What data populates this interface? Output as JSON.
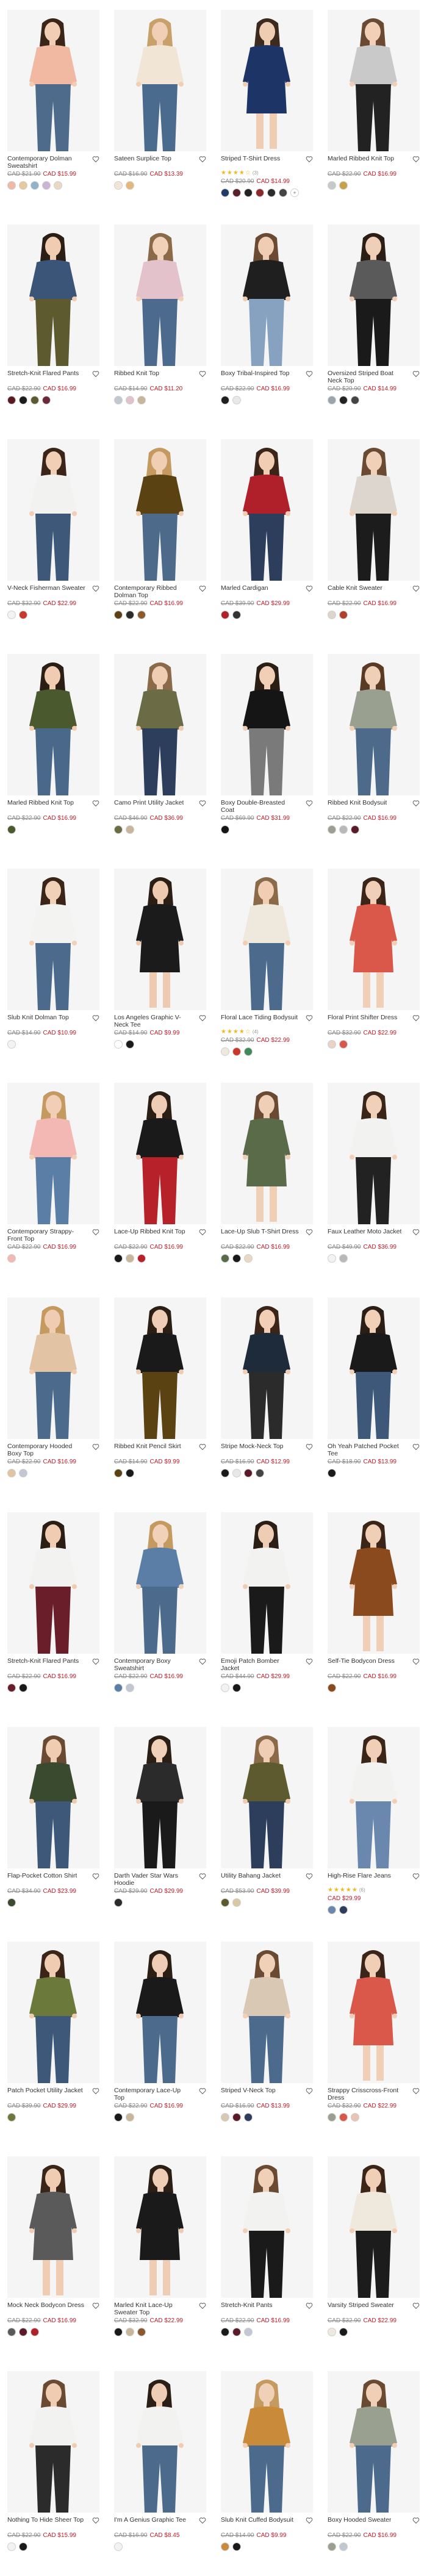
{
  "ui": {
    "heart_label": "Add to wishlist",
    "plus_label": "+"
  },
  "products": [
    {
      "name": "Contemporary Dolman Sweatshirt",
      "orig": "CAD $21.90",
      "sale": "CAD $15.99",
      "rating": 0,
      "reviews": "",
      "skin": "#f2cdb5",
      "hair": "#3a2518",
      "top": "#f1b8a2",
      "bottom": "#4e6b8c",
      "bg": "#f5f5f5",
      "swatches": [
        "#f1b8a2",
        "#e7c89f",
        "#8fb3c9",
        "#c9b5d6",
        "#e8d8c4"
      ]
    },
    {
      "name": "Sateen Surplice Top",
      "orig": "CAD $16.90",
      "sale": "CAD $13.39",
      "rating": 0,
      "reviews": "",
      "skin": "#f0cfb6",
      "hair": "#c7a06a",
      "top": "#f1e6d6",
      "bottom": "#4b6b8e",
      "bg": "#f5f5f5",
      "swatches": [
        "#f1e6d6",
        "#e3b77f"
      ]
    },
    {
      "name": "Striped T-Shirt Dress",
      "orig": "CAD $20.90",
      "sale": "CAD $14.99",
      "rating": 4,
      "reviews": "(3)",
      "skin": "#efcdb2",
      "hair": "#3b2a1d",
      "top": "#1d3566",
      "bottom": "#1d3566",
      "bg": "#f5f5f5",
      "swatches": [
        "#1f3b6a",
        "#5b1f2b",
        "#222",
        "#8a2a2a",
        "#2b2b2b",
        "#444"
      ],
      "plus": true
    },
    {
      "name": "Marled Ribbed Knit Top",
      "orig": "CAD $22.90",
      "sale": "CAD $16.99",
      "rating": 0,
      "reviews": "",
      "skin": "#f1d0b7",
      "hair": "#6a4a32",
      "top": "#c9c9c9",
      "bottom": "#222",
      "bg": "#f5f5f5",
      "swatches": [
        "#c9c9c9",
        "#c8a14a"
      ]
    },
    {
      "name": "Stretch-Knit Flared Pants",
      "orig": "CAD $22.90",
      "sale": "CAD $16.99",
      "rating": 0,
      "reviews": "",
      "skin": "#f0cdb2",
      "hair": "#2b1e15",
      "top": "#3a5578",
      "bottom": "#5c5a2e",
      "bg": "#f5f5f5",
      "swatches": [
        "#5b1a1f",
        "#1c1c1c",
        "#5c5a2e",
        "#6b2a3a"
      ]
    },
    {
      "name": "Ribbed Knit Top",
      "orig": "CAD $14.90",
      "sale": "CAD $11.20",
      "rating": 0,
      "reviews": "",
      "skin": "#f1d1b8",
      "hair": "#8a6a48",
      "top": "#e3c2cc",
      "bottom": "#4b6a8d",
      "bg": "#f5f5f5",
      "swatches": [
        "#c2c8d2",
        "#e3c2cc",
        "#c8b59a"
      ]
    },
    {
      "name": "Boxy Tribal-Inspired Top",
      "orig": "CAD $22.90",
      "sale": "CAD $16.99",
      "rating": 0,
      "reviews": "",
      "skin": "#eecdb4",
      "hair": "#6a4a32",
      "top": "#1f1f1f",
      "bottom": "#86a2c0",
      "bg": "#f5f5f5",
      "swatches": [
        "#1f1f1f",
        "#e8e8e8"
      ]
    },
    {
      "name": "Oversized Striped Boat Neck Top",
      "orig": "CAD $20.90",
      "sale": "CAD $14.99",
      "rating": 0,
      "reviews": "",
      "skin": "#f0cfb8",
      "hair": "#2b1e15",
      "top": "#5a5a5a",
      "bottom": "#1a1a1a",
      "bg": "#f5f5f5",
      "swatches": [
        "#9aa3b0",
        "#222",
        "#444"
      ]
    },
    {
      "name": "V-Neck Fisherman Sweater",
      "orig": "CAD $32.90",
      "sale": "CAD $22.99",
      "rating": 0,
      "reviews": "",
      "skin": "#f1cfb7",
      "hair": "#3a2518",
      "top": "#f2f2f0",
      "bottom": "#3e5879",
      "bg": "#f5f5f5",
      "swatches": [
        "#f2f2f0",
        "#c7392a"
      ]
    },
    {
      "name": "Contemporary Ribbed Dolman Top",
      "orig": "CAD $22.90",
      "sale": "CAD $16.99",
      "rating": 0,
      "reviews": "",
      "skin": "#f0ceb4",
      "hair": "#c59a60",
      "top": "#5a4212",
      "bottom": "#4d6a8a",
      "bg": "#f5f5f5",
      "swatches": [
        "#5a4212",
        "#2b2b2b",
        "#8a5a2e"
      ]
    },
    {
      "name": "Marled Cardigan",
      "orig": "CAD $39.90",
      "sale": "CAD $29.99",
      "rating": 0,
      "reviews": "",
      "skin": "#f0cdb3",
      "hair": "#3a2518",
      "top": "#b0202a",
      "bottom": "#2c3e5c",
      "bg": "#f5f5f5",
      "swatches": [
        "#b0202a",
        "#333"
      ]
    },
    {
      "name": "Cable Knit Sweater",
      "orig": "CAD $22.90",
      "sale": "CAD $16.99",
      "rating": 0,
      "reviews": "",
      "skin": "#f1d0b8",
      "hair": "#6a4a32",
      "top": "#dcd6cf",
      "bottom": "#1c1c1c",
      "bg": "#f5f5f5",
      "swatches": [
        "#dcd6cf",
        "#b0402a"
      ]
    },
    {
      "name": "Marled Ribbed Knit Top",
      "orig": "CAD $22.90",
      "sale": "CAD $16.99",
      "rating": 0,
      "reviews": "",
      "skin": "#f0cdb2",
      "hair": "#2b1e15",
      "top": "#4a5a2e",
      "bottom": "#4a688a",
      "bg": "#f5f5f5",
      "swatches": [
        "#4a5a2e"
      ]
    },
    {
      "name": "Camo Print Utility Jacket",
      "orig": "CAD $46.90",
      "sale": "CAD $36.99",
      "rating": 0,
      "reviews": "",
      "skin": "#eecdb3",
      "hair": "#8a6a48",
      "top": "#6b6b45",
      "bottom": "#2c3e5c",
      "bg": "#f5f5f5",
      "swatches": [
        "#6b6b45",
        "#c8b59a"
      ]
    },
    {
      "name": "Boxy Double-Breasted Coat",
      "orig": "CAD $69.90",
      "sale": "CAD $31.99",
      "rating": 0,
      "reviews": "",
      "skin": "#f0cfb6",
      "hair": "#2b1e15",
      "top": "#151515",
      "bottom": "#7a7a7a",
      "bg": "#f5f5f5",
      "swatches": [
        "#151515"
      ]
    },
    {
      "name": "Ribbed Knit Bodysuit",
      "orig": "CAD $22.90",
      "sale": "CAD $16.99",
      "rating": 0,
      "reviews": "",
      "skin": "#f0cfb7",
      "hair": "#5a3a24",
      "top": "#9aa090",
      "bottom": "#4d6a8a",
      "bg": "#f5f5f5",
      "swatches": [
        "#9aa090",
        "#b9b9b9",
        "#5b1a2a"
      ]
    },
    {
      "name": "Slub Knit Dolman Top",
      "orig": "CAD $14.90",
      "sale": "CAD $10.99",
      "rating": 0,
      "reviews": "",
      "skin": "#f1d1b8",
      "hair": "#3a2518",
      "top": "#f3f3f1",
      "bottom": "#4b6a8c",
      "bg": "#f5f5f5",
      "swatches": [
        "#f3f3f1"
      ]
    },
    {
      "name": "Los Angeles Graphic V-Neck Tee",
      "orig": "CAD $14.90",
      "sale": "CAD $9.99",
      "rating": 0,
      "reviews": "",
      "skin": "#eecbb0",
      "hair": "#2b1e15",
      "top": "#1b1b1b",
      "bottom": "#1b1b1b",
      "bg": "#f5f5f5",
      "swatches": [
        "#ffffff",
        "#1b1b1b"
      ]
    },
    {
      "name": "Floral Lace Tiding Bodysuit",
      "orig": "CAD $32.90",
      "sale": "CAD $22.99",
      "rating": 4,
      "reviews": "(4)",
      "skin": "#f0cdb3",
      "hair": "#8a6a48",
      "top": "#efe8dc",
      "bottom": "#4b6a8c",
      "bg": "#f5f5f5",
      "swatches": [
        "#efe8dc",
        "#c7392a",
        "#3e8a5a"
      ]
    },
    {
      "name": "Floral Print Shifter Dress",
      "orig": "CAD $32.90",
      "sale": "CAD $22.99",
      "rating": 0,
      "reviews": "",
      "skin": "#f1cfb6",
      "hair": "#3a2518",
      "top": "#d9584a",
      "bottom": "#d9584a",
      "bg": "#f5f5f5",
      "swatches": [
        "#e8d4c4",
        "#d9584a"
      ]
    },
    {
      "name": "Contemporary Strappy-Front Top",
      "orig": "CAD $22.90",
      "sale": "CAD $16.99",
      "rating": 0,
      "reviews": "",
      "skin": "#f0cfb6",
      "hair": "#c59a60",
      "top": "#f3b8b4",
      "bottom": "#5a7ea5",
      "bg": "#f5f5f5",
      "swatches": [
        "#f3b8b4"
      ]
    },
    {
      "name": "Lace-Up Ribbed Knit Top",
      "orig": "CAD $22.90",
      "sale": "CAD $16.99",
      "rating": 0,
      "reviews": "",
      "skin": "#eecdb4",
      "hair": "#2b1e15",
      "top": "#1a1a1a",
      "bottom": "#b7222a",
      "bg": "#f5f5f5",
      "swatches": [
        "#1a1a1a",
        "#c8b59a",
        "#b7222a"
      ]
    },
    {
      "name": "Lace-Up Slub T-Shirt Dress",
      "orig": "CAD $22.90",
      "sale": "CAD $16.99",
      "rating": 0,
      "reviews": "",
      "skin": "#f0cfb7",
      "hair": "#6a4a32",
      "top": "#5a6b4a",
      "bottom": "#5a6b4a",
      "bg": "#f5f5f5",
      "swatches": [
        "#5a6b4a",
        "#1a1a1a",
        "#e8d8c4"
      ]
    },
    {
      "name": "Faux Leather Moto Jacket",
      "orig": "CAD $49.90",
      "sale": "CAD $36.99",
      "rating": 0,
      "reviews": "",
      "skin": "#f1d0b8",
      "hair": "#3a2518",
      "top": "#f2f2f0",
      "bottom": "#222",
      "bg": "#f5f5f5",
      "swatches": [
        "#f2f2f0",
        "#b9b9b9"
      ]
    },
    {
      "name": "Contemporary Hooded Boxy Top",
      "orig": "CAD $22.90",
      "sale": "CAD $16.99",
      "rating": 0,
      "reviews": "",
      "skin": "#f0cdb2",
      "hair": "#c59a60",
      "top": "#e2c3a4",
      "bottom": "#4b6a8c",
      "bg": "#f5f5f5",
      "swatches": [
        "#e2c3a4",
        "#c2c8d2"
      ]
    },
    {
      "name": "Ribbed Knit Pencil Skirt",
      "orig": "CAD $14.90",
      "sale": "CAD $9.99",
      "rating": 0,
      "reviews": "",
      "skin": "#eecdb4",
      "hair": "#2b1e15",
      "top": "#1a1a1a",
      "bottom": "#5a4212",
      "bg": "#f5f5f5",
      "swatches": [
        "#5a4212",
        "#1a1a1a"
      ]
    },
    {
      "name": "Stripe Mock-Neck Top",
      "orig": "CAD $16.90",
      "sale": "CAD $12.99",
      "rating": 0,
      "reviews": "",
      "skin": "#f0cfb6",
      "hair": "#3a2518",
      "top": "#1d2b3a",
      "bottom": "#2b2b2b",
      "bg": "#f5f5f5",
      "swatches": [
        "#1a1a1a",
        "#e8e8e8",
        "#5b1a2a",
        "#444"
      ]
    },
    {
      "name": "Oh Yeah Patched Pocket Tee",
      "orig": "CAD $18.90",
      "sale": "CAD $13.99",
      "rating": 0,
      "reviews": "",
      "skin": "#f1d0b8",
      "hair": "#2b1e15",
      "top": "#1a1a1a",
      "bottom": "#3e5879",
      "bg": "#f5f5f5",
      "swatches": [
        "#1a1a1a"
      ]
    },
    {
      "name": "Stretch-Knit Flared Pants",
      "orig": "CAD $22.90",
      "sale": "CAD $16.99",
      "rating": 0,
      "reviews": "",
      "skin": "#f0cdb2",
      "hair": "#2b1e15",
      "top": "#f2f2f0",
      "bottom": "#6a1e2a",
      "bg": "#f5f5f5",
      "swatches": [
        "#6a1e2a",
        "#1a1a1a"
      ]
    },
    {
      "name": "Contemporary Boxy Sweatshirt",
      "orig": "CAD $22.90",
      "sale": "CAD $16.99",
      "rating": 0,
      "reviews": "",
      "skin": "#f1d1b8",
      "hair": "#c59a60",
      "top": "#5a7ea5",
      "bottom": "#4b6a8c",
      "bg": "#f5f5f5",
      "swatches": [
        "#5a7ea5",
        "#c2c8d2"
      ]
    },
    {
      "name": "Emoji Patch Bomber Jacket",
      "orig": "CAD $44.90",
      "sale": "CAD $29.99",
      "rating": 0,
      "reviews": "",
      "skin": "#eecdb4",
      "hair": "#2b1e15",
      "top": "#f2f2f0",
      "bottom": "#1a1a1a",
      "bg": "#f5f5f5",
      "swatches": [
        "#f2f2f0",
        "#1a1a1a"
      ]
    },
    {
      "name": "Self-Tie Bodycon Dress",
      "orig": "CAD $22.90",
      "sale": "CAD $16.99",
      "rating": 0,
      "reviews": "",
      "skin": "#f0cfb6",
      "hair": "#3a2518",
      "top": "#8a4a1e",
      "bottom": "#8a4a1e",
      "bg": "#f5f5f5",
      "swatches": [
        "#8a4a1e"
      ]
    },
    {
      "name": "Flap-Pocket Cotton Shirt",
      "orig": "CAD $34.90",
      "sale": "CAD $23.99",
      "rating": 0,
      "reviews": "",
      "skin": "#f0cdb2",
      "hair": "#6a4a32",
      "top": "#3a4a2e",
      "bottom": "#3e5879",
      "bg": "#f5f5f5",
      "swatches": [
        "#3a4a2e"
      ]
    },
    {
      "name": "Darth Vader Star Wars Hoodie",
      "orig": "CAD $29.90",
      "sale": "CAD $29.99",
      "rating": 0,
      "reviews": "",
      "skin": "#f1d0b8",
      "hair": "#2b1e15",
      "top": "#2b2b2b",
      "bottom": "#1a1a1a",
      "bg": "#f5f5f5",
      "swatches": [
        "#2b2b2b"
      ]
    },
    {
      "name": "Utility Bahang Jacket",
      "orig": "CAD $53.90",
      "sale": "CAD $39.99",
      "rating": 0,
      "reviews": "",
      "skin": "#eecdb4",
      "hair": "#8a6a48",
      "top": "#5c5a2e",
      "bottom": "#2c3e5c",
      "bg": "#f5f5f5",
      "swatches": [
        "#5c5a2e",
        "#d8c8a4"
      ]
    },
    {
      "name": "High-Rise Flare Jeans",
      "orig": "",
      "sale": "CAD $29.99",
      "rating": 5,
      "reviews": "(6)",
      "skin": "#f0cfb6",
      "hair": "#3a2518",
      "top": "#f2f2f0",
      "bottom": "#6a88ad",
      "bg": "#f5f5f5",
      "swatches": [
        "#6a88ad",
        "#2c3e5c"
      ]
    },
    {
      "name": "Patch Pocket Utility Jacket",
      "orig": "CAD $39.90",
      "sale": "CAD $29.99",
      "rating": 0,
      "reviews": "",
      "skin": "#f0cdb2",
      "hair": "#3a2518",
      "top": "#6b7a3a",
      "bottom": "#3e5879",
      "bg": "#f5f5f5",
      "swatches": [
        "#6b7a3a"
      ]
    },
    {
      "name": "Contemporary Lace-Up Top",
      "orig": "CAD $22.90",
      "sale": "CAD $16.99",
      "rating": 0,
      "reviews": "",
      "skin": "#eecdb4",
      "hair": "#2b1e15",
      "top": "#1a1a1a",
      "bottom": "#4b6a8c",
      "bg": "#f5f5f5",
      "swatches": [
        "#1a1a1a",
        "#c8b59a"
      ]
    },
    {
      "name": "Striped V-Neck Top",
      "orig": "CAD $16.90",
      "sale": "CAD $13.99",
      "rating": 0,
      "reviews": "",
      "skin": "#f1d0b8",
      "hair": "#6a4a32",
      "top": "#d8c8b4",
      "bottom": "#4b6a8c",
      "bg": "#f5f5f5",
      "swatches": [
        "#d8c8b4",
        "#5b1a2a",
        "#2c3e5c"
      ]
    },
    {
      "name": "Strappy Crisscross-Front Dress",
      "orig": "CAD $32.90",
      "sale": "CAD $22.99",
      "rating": 0,
      "reviews": "",
      "skin": "#f0cfb6",
      "hair": "#3a2518",
      "top": "#d9584a",
      "bottom": "#d9584a",
      "bg": "#f5f5f5",
      "swatches": [
        "#9aa090",
        "#d9584a",
        "#e8c4b4"
      ]
    },
    {
      "name": "Mock Neck Bodycon Dress",
      "orig": "CAD $22.90",
      "sale": "CAD $16.99",
      "rating": 0,
      "reviews": "",
      "skin": "#f0cdb2",
      "hair": "#3a2518",
      "top": "#5a5a5a",
      "bottom": "#5a5a5a",
      "bg": "#f5f5f5",
      "swatches": [
        "#5a5a5a",
        "#5b1a2a",
        "#b0202a"
      ]
    },
    {
      "name": "Marled Knit Lace-Up Sweater Top",
      "orig": "CAD $32.90",
      "sale": "CAD $22.99",
      "rating": 0,
      "reviews": "",
      "skin": "#eecdb4",
      "hair": "#2b1e15",
      "top": "#1a1a1a",
      "bottom": "#1a1a1a",
      "bg": "#f5f5f5",
      "swatches": [
        "#1a1a1a",
        "#c8b59a",
        "#8a5a2e"
      ]
    },
    {
      "name": "Stretch-Knit Pants",
      "orig": "CAD $22.90",
      "sale": "CAD $16.99",
      "rating": 0,
      "reviews": "",
      "skin": "#f1d0b8",
      "hair": "#6a4a32",
      "top": "#f2f2f0",
      "bottom": "#1a1a1a",
      "bg": "#f5f5f5",
      "swatches": [
        "#1a1a1a",
        "#5b1a2a",
        "#c2c8d2"
      ]
    },
    {
      "name": "Varsity Striped Sweater",
      "orig": "CAD $32.90",
      "sale": "CAD $22.99",
      "rating": 0,
      "reviews": "",
      "skin": "#f0cfb6",
      "hair": "#3a2518",
      "top": "#efe8dc",
      "bottom": "#1c1c1c",
      "bg": "#f5f5f5",
      "swatches": [
        "#efe8dc",
        "#1a1a1a"
      ]
    },
    {
      "name": "Nothing To Hide Sheer Top",
      "orig": "CAD $22.90",
      "sale": "CAD $15.99",
      "rating": 0,
      "reviews": "",
      "skin": "#f0cdb2",
      "hair": "#6a4a32",
      "top": "#f2f2f0",
      "bottom": "#2b2b2b",
      "bg": "#f5f5f5",
      "swatches": [
        "#f2f2f0",
        "#1a1a1a"
      ]
    },
    {
      "name": "I'm A Genius Graphic Tee",
      "orig": "CAD $16.90",
      "sale": "CAD $8.45",
      "rating": 0,
      "reviews": "",
      "skin": "#eecdb4",
      "hair": "#2b1e15",
      "top": "#f2f2f0",
      "bottom": "#4b6a8c",
      "bg": "#f5f5f5",
      "swatches": [
        "#f2f2f0"
      ]
    },
    {
      "name": "Slub Knit Cuffed Bodysuit",
      "orig": "CAD $14.90",
      "sale": "CAD $9.99",
      "rating": 0,
      "reviews": "",
      "skin": "#f1d0b8",
      "hair": "#c59a60",
      "top": "#c98a3a",
      "bottom": "#4b6a8c",
      "bg": "#f5f5f5",
      "swatches": [
        "#c98a3a",
        "#1a1a1a"
      ]
    },
    {
      "name": "Boxy Hooded Sweater",
      "orig": "CAD $22.90",
      "sale": "CAD $16.99",
      "rating": 0,
      "reviews": "",
      "skin": "#f0cfb6",
      "hair": "#6a4a32",
      "top": "#9aa090",
      "bottom": "#4b6a8c",
      "bg": "#f5f5f5",
      "swatches": [
        "#9aa090",
        "#c2c8d2"
      ]
    }
  ]
}
